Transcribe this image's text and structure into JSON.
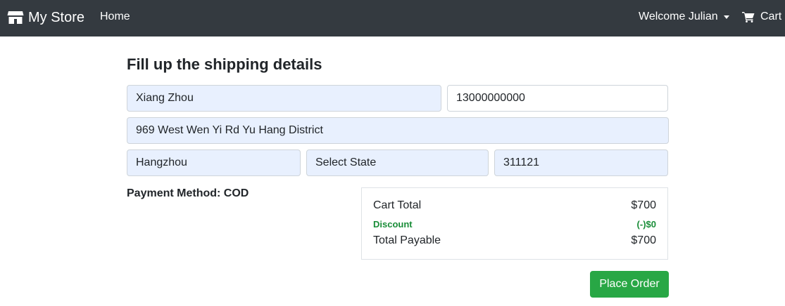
{
  "navbar": {
    "brand": "My Store",
    "brand_icon": "store-icon",
    "home": "Home",
    "welcome": "Welcome Julian",
    "cart": "Cart",
    "cart_icon": "cart-icon"
  },
  "form": {
    "heading": "Fill up the shipping details",
    "name": "Xiang Zhou",
    "phone": "13000000000",
    "address": "969 West Wen Yi Rd Yu Hang District",
    "city": "Hangzhou",
    "state": "Select State",
    "zip": "311121"
  },
  "payment": {
    "label": "Payment Method:",
    "value": "COD"
  },
  "summary": {
    "cart_total_label": "Cart Total",
    "cart_total_value": "$700",
    "discount_label": "Discount",
    "discount_value": "(-)$0",
    "total_payable_label": "Total Payable",
    "total_payable_value": "$700"
  },
  "actions": {
    "place_order": "Place Order"
  },
  "colors": {
    "navbar_bg": "#343a40",
    "autofill_bg": "#e8f0fe",
    "discount_text": "#198d38",
    "button_bg": "#28a745"
  }
}
